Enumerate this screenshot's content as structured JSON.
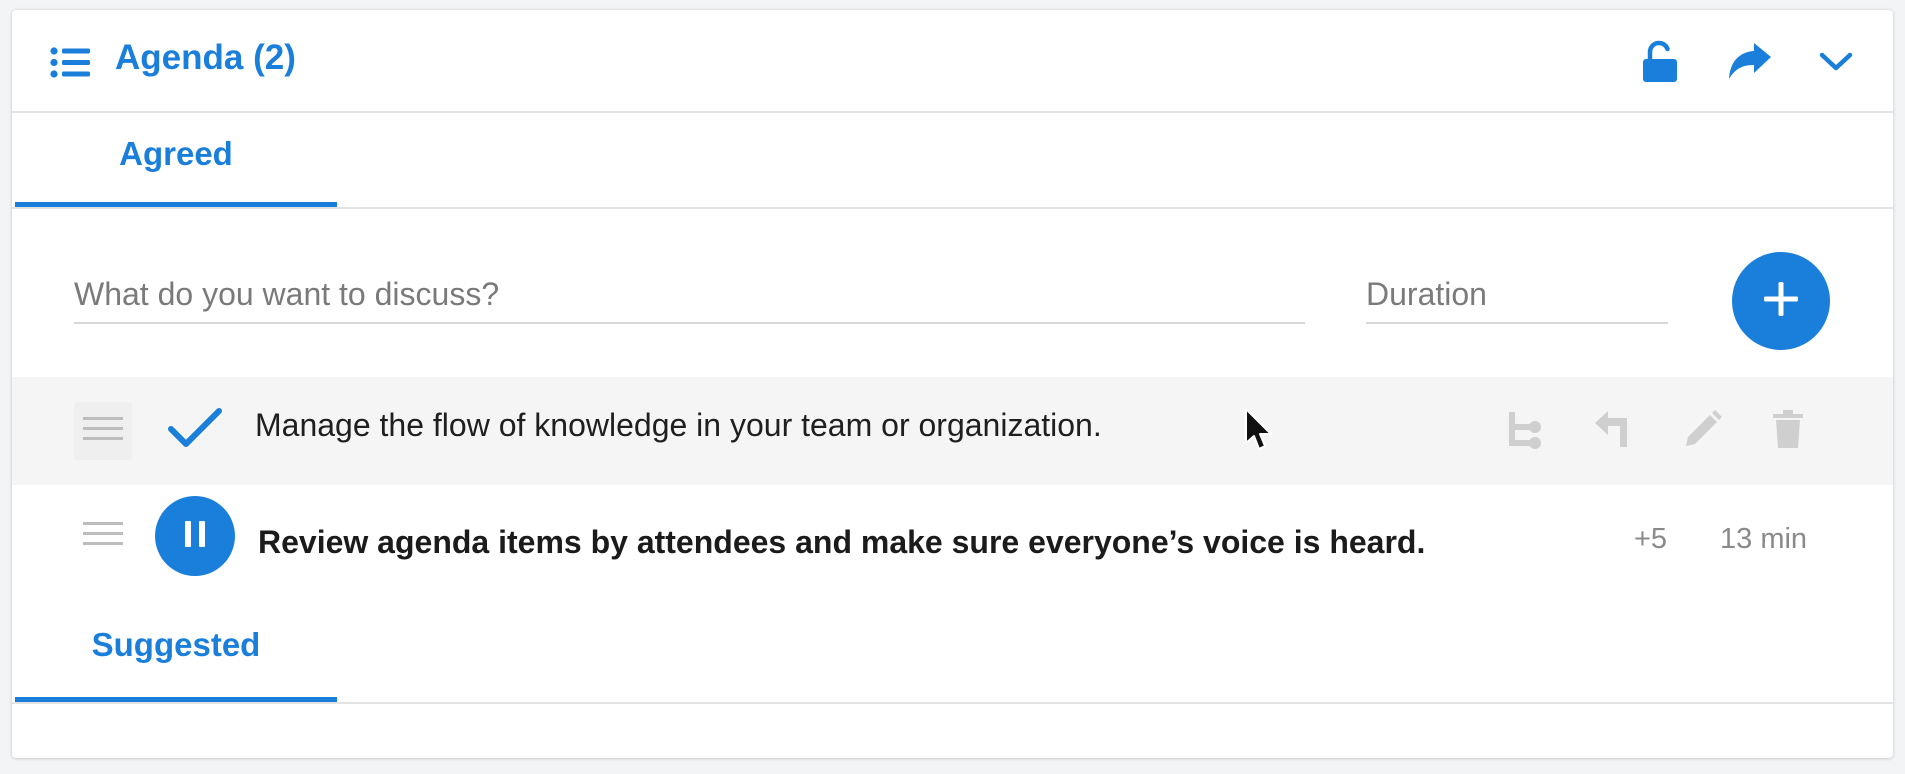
{
  "header": {
    "title": "Agenda (2)",
    "icons": {
      "list": "list-icon",
      "lock": "unlock-icon",
      "share": "share-forward-icon",
      "collapse": "chevron-down-icon"
    }
  },
  "tabs": {
    "agreed": "Agreed",
    "suggested": "Suggested"
  },
  "new_item": {
    "topic_placeholder": "What do you want to discuss?",
    "duration_placeholder": "Duration",
    "add_icon": "plus-icon"
  },
  "items": [
    {
      "text": "Manage the flow of knowledge in your team or organization.",
      "status_icon": "check-icon",
      "actions": [
        "subitem-icon",
        "reply-icon",
        "edit-icon",
        "trash-icon"
      ]
    },
    {
      "text": "Review agenda items by attendees and make sure everyone’s voice is heard.",
      "status_icon": "pause-icon",
      "votes": "+5",
      "duration": "13 min"
    }
  ],
  "colors": {
    "accent": "#1a7edb",
    "muted_icon": "#cfcfcf",
    "divider": "#e3e3e3",
    "row_highlight": "#f5f5f5"
  }
}
